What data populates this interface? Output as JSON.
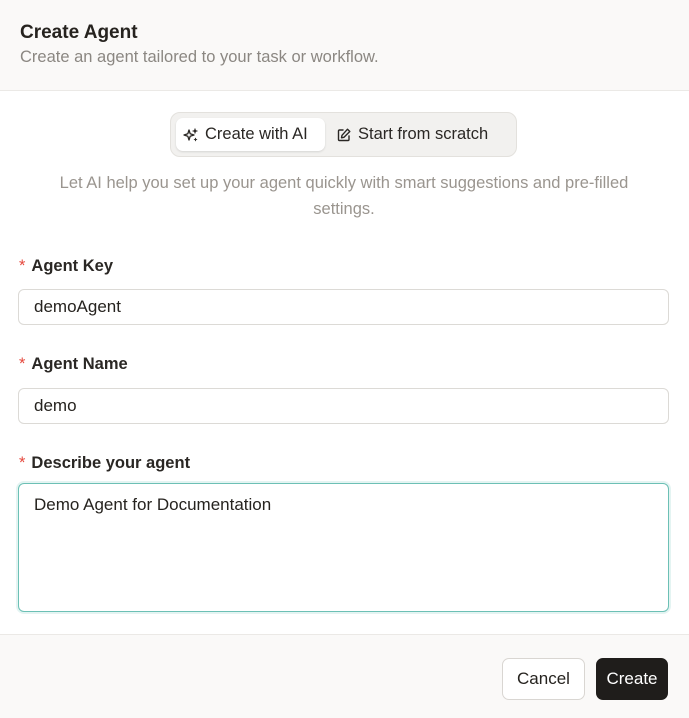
{
  "dialog": {
    "title": "Create Agent",
    "subtitle": "Create an agent tailored to your task or workflow."
  },
  "mode_toggle": {
    "ai_label": "Create with AI",
    "ai_icon": "sparkles-icon",
    "scratch_label": "Start from scratch",
    "scratch_icon": "edit-icon",
    "selected": "Create with AI"
  },
  "hint": "Let AI help you set up your agent quickly with smart suggestions and pre-filled settings.",
  "form": {
    "required_marker": "*",
    "agent_key": {
      "label": "Agent Key",
      "value": "demoAgent"
    },
    "agent_name": {
      "label": "Agent Name",
      "value": "demo"
    },
    "description": {
      "label": "Describe your agent",
      "value": "Demo Agent for Documentation"
    }
  },
  "footer": {
    "cancel_label": "Cancel",
    "create_label": "Create"
  },
  "colors": {
    "required": "#e5483d",
    "focus_border": "#6cc0b5",
    "primary_button": "#1f1d1b"
  }
}
